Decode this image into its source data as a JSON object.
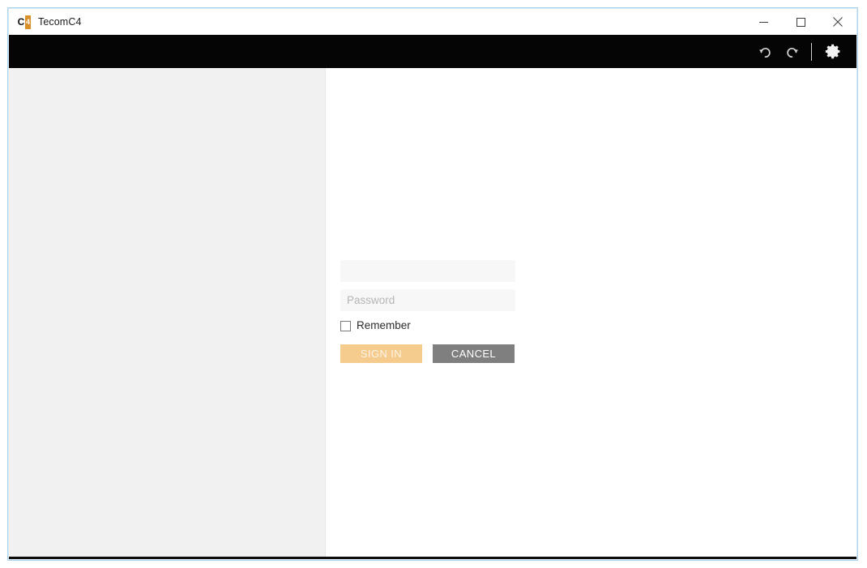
{
  "window": {
    "title": "TecomC4",
    "icon_name": "tecomc4-app-icon",
    "icon_letter": "C",
    "icon_digit": "4",
    "controls": {
      "minimize_label": "Minimize",
      "maximize_label": "Maximize",
      "close_label": "Close"
    }
  },
  "toolbar": {
    "undo_label": "Undo",
    "redo_label": "Redo",
    "settings_label": "Settings",
    "background_color": "#050505"
  },
  "login": {
    "username": {
      "value": "",
      "placeholder": ""
    },
    "password": {
      "value": "",
      "placeholder": "Password"
    },
    "remember": {
      "label": "Remember",
      "checked": false
    },
    "sign_in_label": "SIGN IN",
    "cancel_label": "CANCEL",
    "sign_in_color": "#f5cb8e",
    "cancel_color": "#7f7f7f"
  },
  "panes": {
    "left_background": "#f1f1f1",
    "right_background": "#ffffff"
  }
}
